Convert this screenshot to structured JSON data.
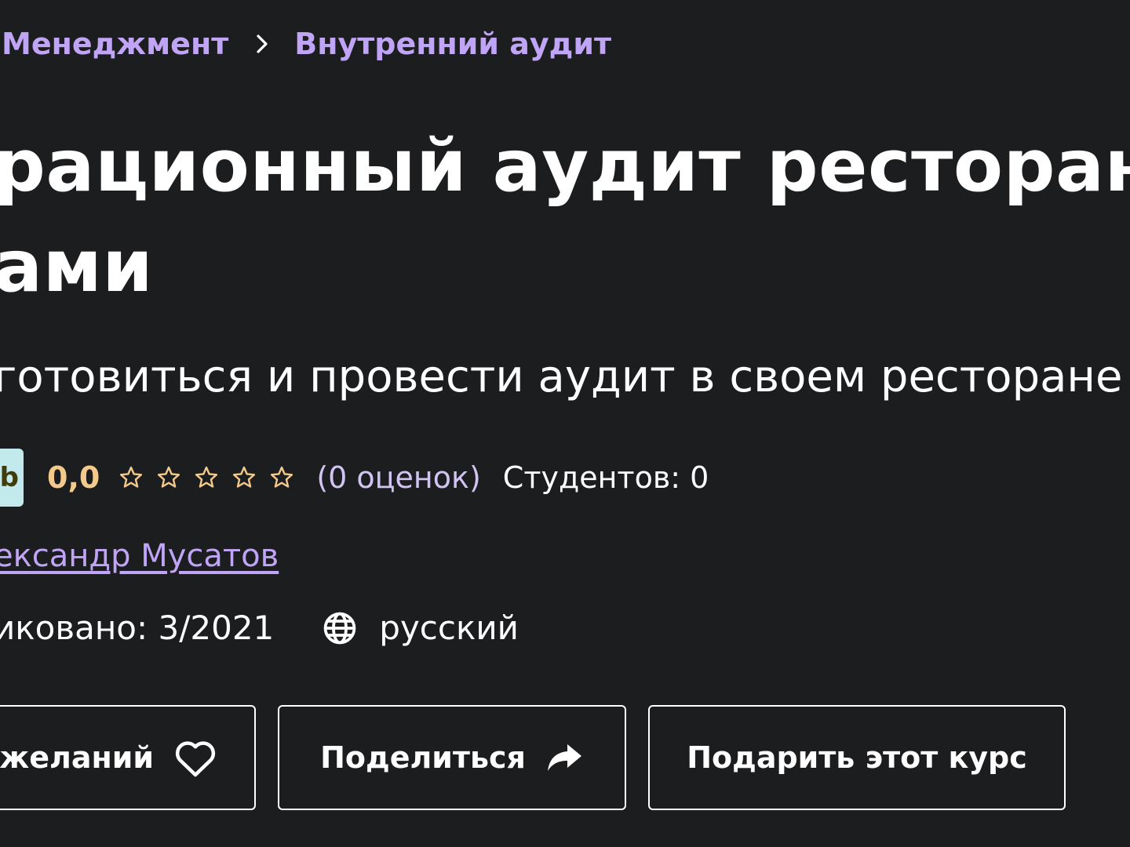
{
  "breadcrumb": {
    "items": [
      "Менеджмент",
      "Внутренний аудит"
    ]
  },
  "course": {
    "title_line1": "рационный аудит ресторана",
    "title_line2": "ами",
    "subtitle": "готовиться и провести аудит в своем ресторане",
    "badge": "b",
    "rating_value": "0,0",
    "rating_stars": 0,
    "rating_count": "(0 оценок)",
    "students": "Студентов: 0",
    "author": "ександр Мусатов",
    "published": "иковано: 3/2021",
    "language": "русский"
  },
  "actions": {
    "wishlist_label": "желаний",
    "share_label": "Поделиться",
    "gift_label": "Подарить этот курс"
  },
  "colors": {
    "background": "#1c1d1f",
    "link": "#c0a4f6",
    "rating": "#f3ca8c",
    "badge": "#c2e9eb"
  },
  "icons": {
    "breadcrumb_separator": "chevron-right-icon",
    "rating": "star-outline-icon",
    "language": "globe-icon",
    "wishlist": "heart-outline-icon",
    "share": "share-arrow-icon"
  }
}
